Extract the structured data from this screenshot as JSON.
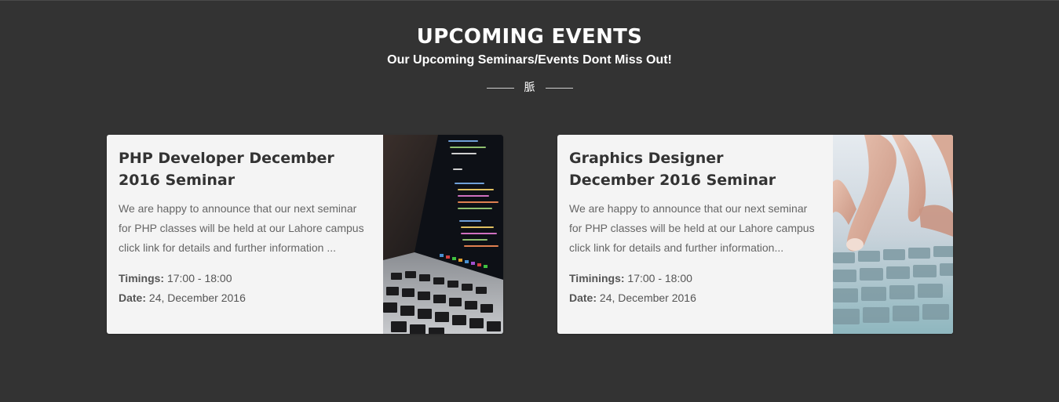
{
  "header": {
    "title": "UPCOMING EVENTS",
    "subtitle": "Our Upcoming Seminars/Events Dont Miss Out!",
    "divider_icon": "脈",
    "divider_icon_name": "decorative-glyph-icon"
  },
  "colors": {
    "background": "#333333",
    "card_background": "#f4f4f4",
    "title_text": "#333333",
    "body_text": "#666666"
  },
  "events": [
    {
      "title": "PHP Developer December 2016 Seminar",
      "description": "We are happy to announce that our next seminar for PHP classes will be held at our Lahore campus click link for details and further information ...",
      "timings_label": "Timings:",
      "timings_value": "17:00 - 18:00",
      "date_label": "Date:",
      "date_value": "24, December 2016",
      "image": "laptop-code-photo"
    },
    {
      "title": "Graphics Designer December 2016 Seminar",
      "description": "We are happy to announce that our next seminar for PHP classes will be held at our Lahore campus click link for details and further information...",
      "timings_label": "Timinings:",
      "timings_value": "17:00 - 18:00",
      "date_label": "Date:",
      "date_value": "24, December 2016",
      "image": "keyboard-finger-photo"
    }
  ]
}
